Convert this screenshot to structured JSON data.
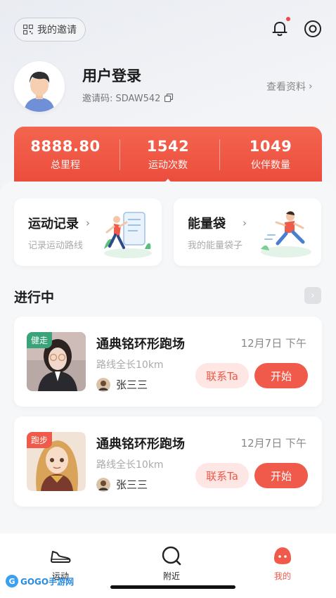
{
  "header": {
    "invite_label": "我的邀请",
    "user_name": "用户登录",
    "invite_code": "邀请码: SDAW542",
    "view_profile": "查看资料"
  },
  "stats": [
    {
      "value": "8888.80",
      "label": "总里程"
    },
    {
      "value": "1542",
      "label": "运动次数"
    },
    {
      "value": "1049",
      "label": "伙伴数量"
    }
  ],
  "quick_cards": [
    {
      "title": "运动记录",
      "subtitle": "记录运动路线"
    },
    {
      "title": "能量袋",
      "subtitle": "我的能量袋子"
    }
  ],
  "section": {
    "title": "进行中"
  },
  "activities": [
    {
      "tag": "健走",
      "tag_color": "#3aa37a",
      "title": "通典铭环形跑场",
      "date": "12月7日 下午",
      "distance": "路线全长10km",
      "user": "张三三",
      "contact_label": "联系Ta",
      "start_label": "开始"
    },
    {
      "tag": "跑步",
      "tag_color": "#ef5a4a",
      "title": "通典铭环形跑场",
      "date": "12月7日 下午",
      "distance": "路线全长10km",
      "user": "张三三",
      "contact_label": "联系Ta",
      "start_label": "开始"
    }
  ],
  "tabbar": [
    {
      "label": "运动",
      "icon": "sneaker-icon",
      "active": false
    },
    {
      "label": "附近",
      "icon": "search-icon",
      "active": false
    },
    {
      "label": "我的",
      "icon": "profile-icon",
      "active": true
    }
  ],
  "colors": {
    "accent": "#ef5a4a",
    "accent_soft": "#fde6e4",
    "walk_tag": "#3aa37a"
  },
  "watermark": "GOGO手游网"
}
